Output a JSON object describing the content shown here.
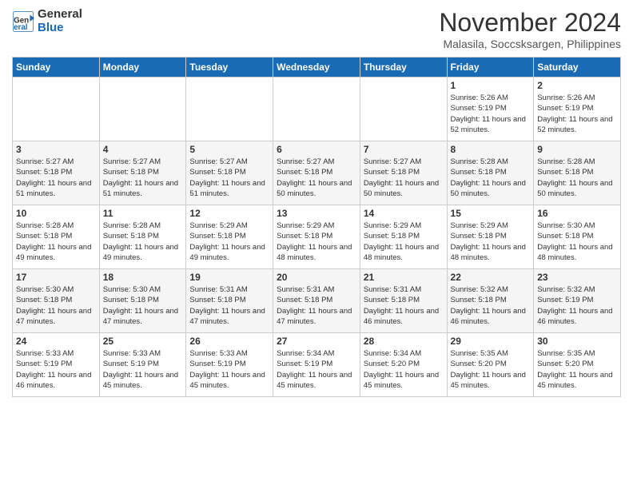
{
  "header": {
    "logo_line1": "General",
    "logo_line2": "Blue",
    "month": "November 2024",
    "location": "Malasila, Soccsksargen, Philippines"
  },
  "weekdays": [
    "Sunday",
    "Monday",
    "Tuesday",
    "Wednesday",
    "Thursday",
    "Friday",
    "Saturday"
  ],
  "weeks": [
    [
      {
        "day": "",
        "info": ""
      },
      {
        "day": "",
        "info": ""
      },
      {
        "day": "",
        "info": ""
      },
      {
        "day": "",
        "info": ""
      },
      {
        "day": "",
        "info": ""
      },
      {
        "day": "1",
        "info": "Sunrise: 5:26 AM\nSunset: 5:19 PM\nDaylight: 11 hours and 52 minutes."
      },
      {
        "day": "2",
        "info": "Sunrise: 5:26 AM\nSunset: 5:19 PM\nDaylight: 11 hours and 52 minutes."
      }
    ],
    [
      {
        "day": "3",
        "info": "Sunrise: 5:27 AM\nSunset: 5:18 PM\nDaylight: 11 hours and 51 minutes."
      },
      {
        "day": "4",
        "info": "Sunrise: 5:27 AM\nSunset: 5:18 PM\nDaylight: 11 hours and 51 minutes."
      },
      {
        "day": "5",
        "info": "Sunrise: 5:27 AM\nSunset: 5:18 PM\nDaylight: 11 hours and 51 minutes."
      },
      {
        "day": "6",
        "info": "Sunrise: 5:27 AM\nSunset: 5:18 PM\nDaylight: 11 hours and 50 minutes."
      },
      {
        "day": "7",
        "info": "Sunrise: 5:27 AM\nSunset: 5:18 PM\nDaylight: 11 hours and 50 minutes."
      },
      {
        "day": "8",
        "info": "Sunrise: 5:28 AM\nSunset: 5:18 PM\nDaylight: 11 hours and 50 minutes."
      },
      {
        "day": "9",
        "info": "Sunrise: 5:28 AM\nSunset: 5:18 PM\nDaylight: 11 hours and 50 minutes."
      }
    ],
    [
      {
        "day": "10",
        "info": "Sunrise: 5:28 AM\nSunset: 5:18 PM\nDaylight: 11 hours and 49 minutes."
      },
      {
        "day": "11",
        "info": "Sunrise: 5:28 AM\nSunset: 5:18 PM\nDaylight: 11 hours and 49 minutes."
      },
      {
        "day": "12",
        "info": "Sunrise: 5:29 AM\nSunset: 5:18 PM\nDaylight: 11 hours and 49 minutes."
      },
      {
        "day": "13",
        "info": "Sunrise: 5:29 AM\nSunset: 5:18 PM\nDaylight: 11 hours and 48 minutes."
      },
      {
        "day": "14",
        "info": "Sunrise: 5:29 AM\nSunset: 5:18 PM\nDaylight: 11 hours and 48 minutes."
      },
      {
        "day": "15",
        "info": "Sunrise: 5:29 AM\nSunset: 5:18 PM\nDaylight: 11 hours and 48 minutes."
      },
      {
        "day": "16",
        "info": "Sunrise: 5:30 AM\nSunset: 5:18 PM\nDaylight: 11 hours and 48 minutes."
      }
    ],
    [
      {
        "day": "17",
        "info": "Sunrise: 5:30 AM\nSunset: 5:18 PM\nDaylight: 11 hours and 47 minutes."
      },
      {
        "day": "18",
        "info": "Sunrise: 5:30 AM\nSunset: 5:18 PM\nDaylight: 11 hours and 47 minutes."
      },
      {
        "day": "19",
        "info": "Sunrise: 5:31 AM\nSunset: 5:18 PM\nDaylight: 11 hours and 47 minutes."
      },
      {
        "day": "20",
        "info": "Sunrise: 5:31 AM\nSunset: 5:18 PM\nDaylight: 11 hours and 47 minutes."
      },
      {
        "day": "21",
        "info": "Sunrise: 5:31 AM\nSunset: 5:18 PM\nDaylight: 11 hours and 46 minutes."
      },
      {
        "day": "22",
        "info": "Sunrise: 5:32 AM\nSunset: 5:18 PM\nDaylight: 11 hours and 46 minutes."
      },
      {
        "day": "23",
        "info": "Sunrise: 5:32 AM\nSunset: 5:19 PM\nDaylight: 11 hours and 46 minutes."
      }
    ],
    [
      {
        "day": "24",
        "info": "Sunrise: 5:33 AM\nSunset: 5:19 PM\nDaylight: 11 hours and 46 minutes."
      },
      {
        "day": "25",
        "info": "Sunrise: 5:33 AM\nSunset: 5:19 PM\nDaylight: 11 hours and 45 minutes."
      },
      {
        "day": "26",
        "info": "Sunrise: 5:33 AM\nSunset: 5:19 PM\nDaylight: 11 hours and 45 minutes."
      },
      {
        "day": "27",
        "info": "Sunrise: 5:34 AM\nSunset: 5:19 PM\nDaylight: 11 hours and 45 minutes."
      },
      {
        "day": "28",
        "info": "Sunrise: 5:34 AM\nSunset: 5:20 PM\nDaylight: 11 hours and 45 minutes."
      },
      {
        "day": "29",
        "info": "Sunrise: 5:35 AM\nSunset: 5:20 PM\nDaylight: 11 hours and 45 minutes."
      },
      {
        "day": "30",
        "info": "Sunrise: 5:35 AM\nSunset: 5:20 PM\nDaylight: 11 hours and 45 minutes."
      }
    ]
  ]
}
